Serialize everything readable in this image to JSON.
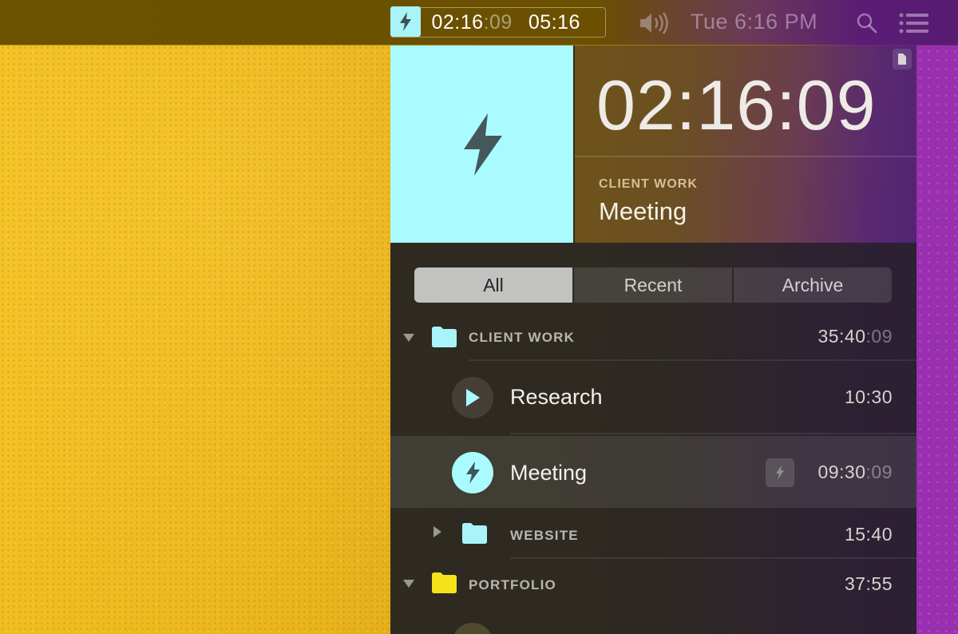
{
  "menubar": {
    "timer_main": "02:16",
    "timer_seconds": ":09",
    "timer_total": "05:16",
    "clock": "Tue 6:16 PM",
    "icons": [
      "bolt-icon",
      "volume-icon",
      "search-icon",
      "list-icon"
    ]
  },
  "hero": {
    "timer": "02:16:09",
    "category": "CLIENT WORK",
    "task": "Meeting",
    "accent": "#a9fbff"
  },
  "tabs": [
    {
      "label": "All",
      "active": true
    },
    {
      "label": "Recent",
      "active": false
    },
    {
      "label": "Archive",
      "active": false
    }
  ],
  "list": {
    "client_work": {
      "label": "CLIENT WORK",
      "time": "35:40",
      "time_seconds": ":09",
      "folder_color": "#a9f3fb"
    },
    "research": {
      "label": "Research",
      "time": "10:30"
    },
    "meeting": {
      "label": "Meeting",
      "time": "09:30",
      "time_seconds": ":09"
    },
    "website": {
      "label": "WEBSITE",
      "time": "15:40",
      "folder_color": "#a9f3fb"
    },
    "portfolio": {
      "label": "PORTFOLIO",
      "time": "37:55",
      "folder_color": "#f6e21a"
    }
  }
}
